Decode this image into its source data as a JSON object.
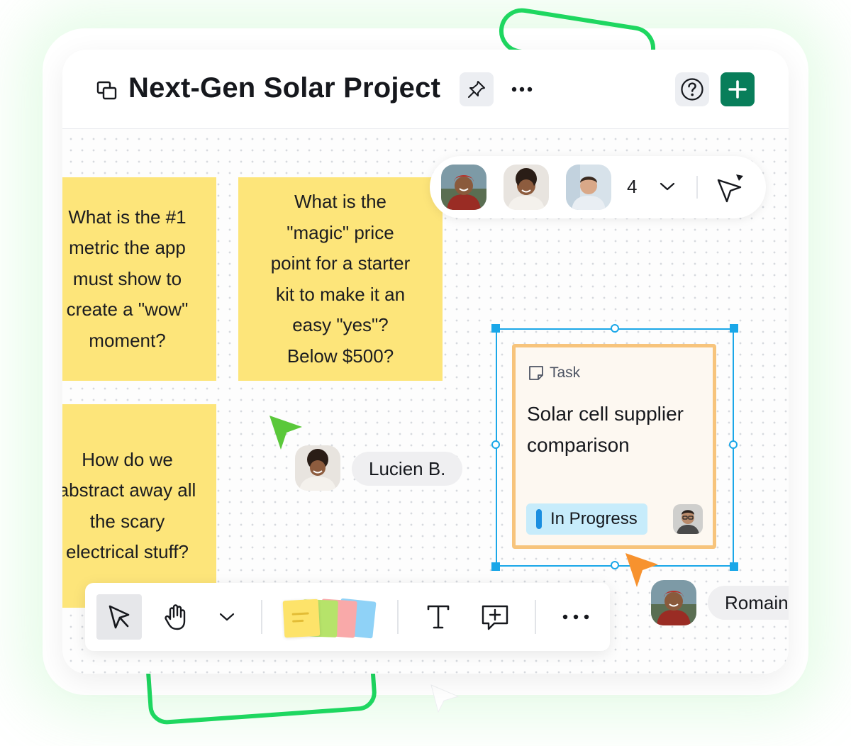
{
  "header": {
    "title": "Next-Gen Solar Project",
    "board_icon": "board-copy-icon",
    "pin_icon": "pin-icon",
    "more_icon": "more-horizontal-icon",
    "help_icon": "help-circle-icon",
    "add_icon": "plus-icon"
  },
  "stickies": [
    {
      "text": "What is the #1\nmetric the app\nmust show to\ncreate a \"wow\"\nmoment?"
    },
    {
      "text": "What is the\n\"magic\" price\npoint for a starter\nkit to make it an\neasy \"yes\"?\nBelow $500?"
    },
    {
      "text": "How do we\nabstract away all\nthe scary\nelectrical stuff?"
    }
  ],
  "presence": {
    "count": "4",
    "chevron_icon": "chevron-down-icon",
    "cursor_icon": "cursor-arrow-icon"
  },
  "task": {
    "type": "Task",
    "type_icon": "sticky-note-icon",
    "title": "Solar cell supplier\ncomparison",
    "status": "In Progress"
  },
  "collaborators": [
    {
      "name": "Lucien B.",
      "cursor_color": "#5ac83a"
    },
    {
      "name": "Romain",
      "cursor_color": "#f7922e"
    }
  ],
  "toolbar": {
    "tools": [
      "select-icon",
      "hand-icon",
      "chevron-down-icon",
      "sticky-notes-icon",
      "text-icon",
      "comment-add-icon",
      "more-horizontal-icon"
    ]
  },
  "colors": {
    "brand_green": "#087e5a",
    "sticky_yellow": "#fde57a",
    "selection_blue": "#1aa7e8",
    "task_border": "#f7c47c",
    "status_bg": "#c7ecfb",
    "deco_green": "#1ed760"
  }
}
